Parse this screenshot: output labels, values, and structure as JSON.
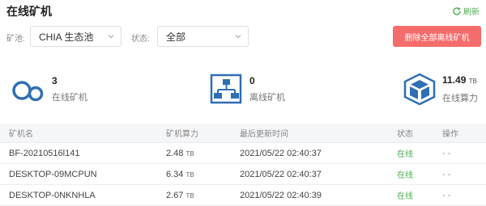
{
  "header": {
    "title": "在线矿机",
    "refresh_label": "刷新"
  },
  "filters": {
    "pool_label": "矿池:",
    "pool_value": "CHIA 生态池",
    "status_label": "状态:",
    "status_value": "全部"
  },
  "actions": {
    "delete_offline_label": "删除全部离线矿机"
  },
  "stats": {
    "online_count": "3",
    "online_caption": "在线矿机",
    "offline_count": "0",
    "offline_caption": "离线矿机",
    "power_value": "11.49",
    "power_unit": "TB",
    "power_caption": "在线算力"
  },
  "colors": {
    "accent_blue": "#2f6fb3",
    "danger": "#f56c6c",
    "online_green": "#4caf50"
  },
  "table": {
    "headers": [
      "矿机名",
      "矿机算力",
      "最后更新时间",
      "状态",
      "操作"
    ],
    "rows": [
      {
        "name": "BF-20210516l141",
        "power": "2.48",
        "unit": "TB",
        "time": "2021/05/22 02:40:37",
        "status": "在线",
        "action": "- -"
      },
      {
        "name": "DESKTOP-09MCPUN",
        "power": "6.34",
        "unit": "TB",
        "time": "2021/05/22 02:40:37",
        "status": "在线",
        "action": "- -"
      },
      {
        "name": "DESKTOP-0NKNHLA",
        "power": "2.67",
        "unit": "TB",
        "time": "2021/05/22 02:40:39",
        "status": "在线",
        "action": "- -"
      }
    ]
  }
}
